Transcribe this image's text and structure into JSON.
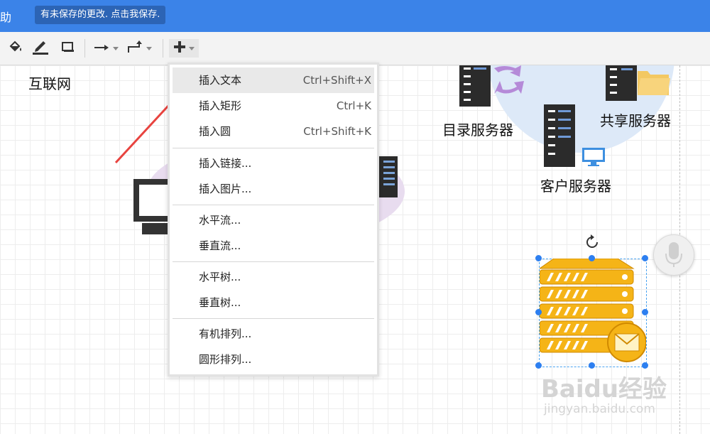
{
  "topbar": {
    "help_menu": "助",
    "unsaved_notice": "有未保存的更改. 点击我保存."
  },
  "toolbar": {
    "fill_icon": "paint-bucket-icon",
    "line_icon": "pen-icon",
    "shadow_icon": "shadow-rect-icon",
    "connector_icon": "straight-arrow-icon",
    "waypoint_icon": "elbow-connector-icon",
    "insert_icon": "plus-icon"
  },
  "canvas": {
    "labels": {
      "internet": "互联网",
      "directory_server": "目录服务器",
      "shared_server": "共享服务器",
      "client_server": "客户服务器"
    }
  },
  "insert_menu": {
    "items": [
      {
        "label": "插入文本",
        "shortcut": "Ctrl+Shift+X"
      },
      {
        "label": "插入矩形",
        "shortcut": "Ctrl+K"
      },
      {
        "label": "插入圆",
        "shortcut": "Ctrl+Shift+K"
      },
      {
        "label": "插入链接...",
        "shortcut": ""
      },
      {
        "label": "插入图片...",
        "shortcut": ""
      },
      {
        "label": "水平流...",
        "shortcut": ""
      },
      {
        "label": "垂直流...",
        "shortcut": ""
      },
      {
        "label": "水平树...",
        "shortcut": ""
      },
      {
        "label": "垂直树...",
        "shortcut": ""
      },
      {
        "label": "有机排列...",
        "shortcut": ""
      },
      {
        "label": "圆形排列...",
        "shortcut": ""
      }
    ]
  },
  "watermark": {
    "brand": "Baidu经验",
    "url": "jingyan.baidu.com"
  },
  "colors": {
    "topbar": "#3b83e8",
    "accent_arrow": "#e8433f",
    "server_gold": "#f5b417"
  }
}
